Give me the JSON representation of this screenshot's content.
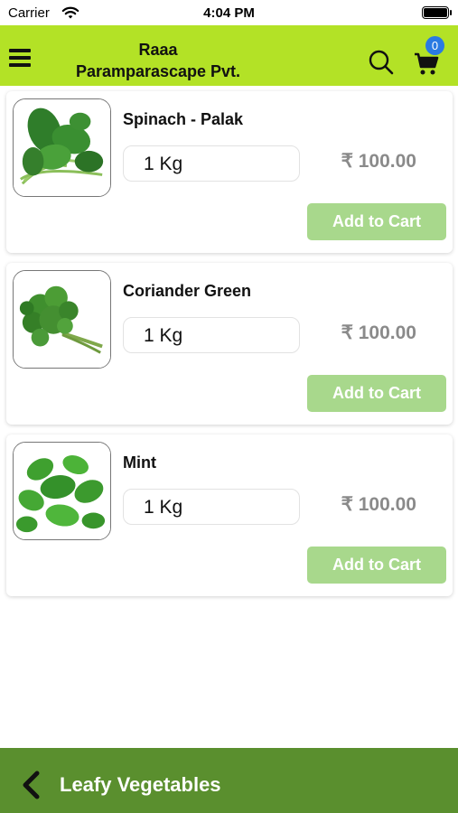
{
  "status_bar": {
    "carrier": "Carrier",
    "time": "4:04 PM"
  },
  "header": {
    "title_line1": "Raaa",
    "title_line2": "Paramparascape Pvt.",
    "cart_count": "0",
    "menu_icon": "hamburger-menu-icon",
    "search_icon": "search-icon",
    "cart_icon": "shopping-cart-icon",
    "background_color": "#b3e226",
    "badge_color": "#2a7ae2"
  },
  "products": [
    {
      "name": "Spinach - Palak",
      "quantity": "1 Kg",
      "price": "₹ 100.00",
      "button_label": "Add to Cart",
      "image": "spinach-image"
    },
    {
      "name": "Coriander Green",
      "quantity": "1 Kg",
      "price": "₹ 100.00",
      "button_label": "Add to Cart",
      "image": "coriander-image"
    },
    {
      "name": "Mint",
      "quantity": "1 Kg",
      "price": "₹ 100.00",
      "button_label": "Add to Cart",
      "image": "mint-image"
    }
  ],
  "button_color": "#a8d88c",
  "bottom_bar": {
    "title": "Leafy Vegetables",
    "back_icon": "chevron-left-icon",
    "background_color": "#5a8f2e"
  }
}
